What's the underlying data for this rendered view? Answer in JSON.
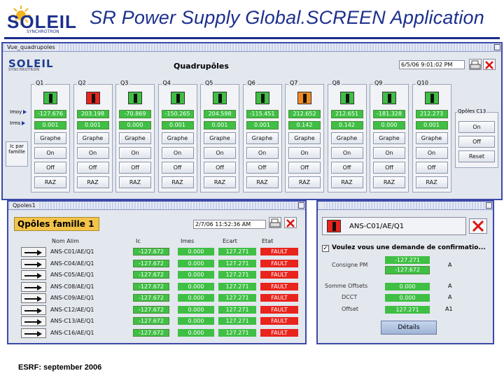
{
  "slide": {
    "title": "SR Power Supply Global.SCREEN Application",
    "footer": "ESRF: september 2006",
    "logo_text": "SOLEIL",
    "logo_sub": "SYNCHROTRON"
  },
  "colors": {
    "ok": "#3fbf44",
    "fault": "#e8241c",
    "warn": "#f08a22",
    "accent": "#1c2f8c"
  },
  "quad_window": {
    "title": "Vue_quadrupoles",
    "heading": "Quadrupôles",
    "datetime": "6/5/06 9:01:02 PM",
    "row_labels": [
      "Imoy",
      "Irms"
    ],
    "left_label": "Ic par famille",
    "button_labels": {
      "graph": "Graphe",
      "on": "On",
      "off": "Off",
      "raz": "RAZ"
    },
    "columns": [
      {
        "name": "Q1",
        "state": "ok",
        "imoy": "-127.676",
        "irms": "0.001"
      },
      {
        "name": "Q2",
        "state": "fault",
        "imoy": "203.198",
        "irms": "0.001"
      },
      {
        "name": "Q3",
        "state": "ok",
        "imoy": "-70.869",
        "irms": "0.000"
      },
      {
        "name": "Q4",
        "state": "ok",
        "imoy": "-150.265",
        "irms": "0.001"
      },
      {
        "name": "Q5",
        "state": "ok",
        "imoy": "204.598",
        "irms": "0.001"
      },
      {
        "name": "Q6",
        "state": "ok",
        "imoy": "-115.451",
        "irms": "0.001"
      },
      {
        "name": "Q7",
        "state": "warn",
        "imoy": "212.652",
        "irms": "0.142"
      },
      {
        "name": "Q8",
        "state": "ok",
        "imoy": "212.651",
        "irms": "0.142"
      },
      {
        "name": "Q9",
        "state": "ok",
        "imoy": "-181.328",
        "irms": "0.000"
      },
      {
        "name": "Q10",
        "state": "ok",
        "imoy": "212.273",
        "irms": "0.001"
      }
    ],
    "side_panel": {
      "label": "Qpôles C13",
      "on": "On",
      "off": "Off",
      "reset": "Reset"
    }
  },
  "family_window": {
    "title": "Qpoles1",
    "heading": "Qpôles famille 1",
    "datetime": "2/7/06 11:52:36 AM",
    "headers": {
      "name": "Nom Alim",
      "ic": "Ic",
      "imes": "Imes",
      "ecart": "Ecart",
      "etat": "Etat"
    },
    "rows": [
      {
        "name": "ANS-C01/AE/Q1",
        "ic": "-127.672",
        "imes": "0.000",
        "ecart": "127.271",
        "etat": "FAULT"
      },
      {
        "name": "ANS-C04/AE/Q1",
        "ic": "-127.672",
        "imes": "0.000",
        "ecart": "127.271",
        "etat": "FAULT"
      },
      {
        "name": "ANS-C05/AE/Q1",
        "ic": "-127.672",
        "imes": "0.000",
        "ecart": "127.271",
        "etat": "FAULT"
      },
      {
        "name": "ANS-C08/AE/Q1",
        "ic": "-127.672",
        "imes": "0.000",
        "ecart": "127.271",
        "etat": "FAULT"
      },
      {
        "name": "ANS-C09/AE/Q1",
        "ic": "-127.672",
        "imes": "0.000",
        "ecart": "127.271",
        "etat": "FAULT"
      },
      {
        "name": "ANS-C12/AE/Q1",
        "ic": "-127.672",
        "imes": "0.000",
        "ecart": "127.271",
        "etat": "FAULT"
      },
      {
        "name": "ANS-C13/AE/Q1",
        "ic": "-127.672",
        "imes": "0.000",
        "ecart": "127.271",
        "etat": "FAULT"
      },
      {
        "name": "ANS-C16/AE/Q1",
        "ic": "-127.672",
        "imes": "0.000",
        "ecart": "127.271",
        "etat": "FAULT"
      }
    ]
  },
  "detail_window": {
    "title": "",
    "device": "ANS-C01/AE/Q1",
    "confirm_label": "Voulez vous une demande de confirmatio...",
    "consigne_label": "Consigne PM",
    "consigne_values": [
      "-127.271",
      "-127.672"
    ],
    "consigne_unit": "A",
    "offsets_label": "Somme Offsets",
    "offsets_value": "0.000",
    "offsets_unit": "A",
    "dcct_label": "DCCT",
    "dcct_value": "0.000",
    "dcct_unit": "A",
    "offset_label": "Offset",
    "offset_value": "127.271",
    "offset_unit": "A1",
    "details_button": "Détails"
  }
}
